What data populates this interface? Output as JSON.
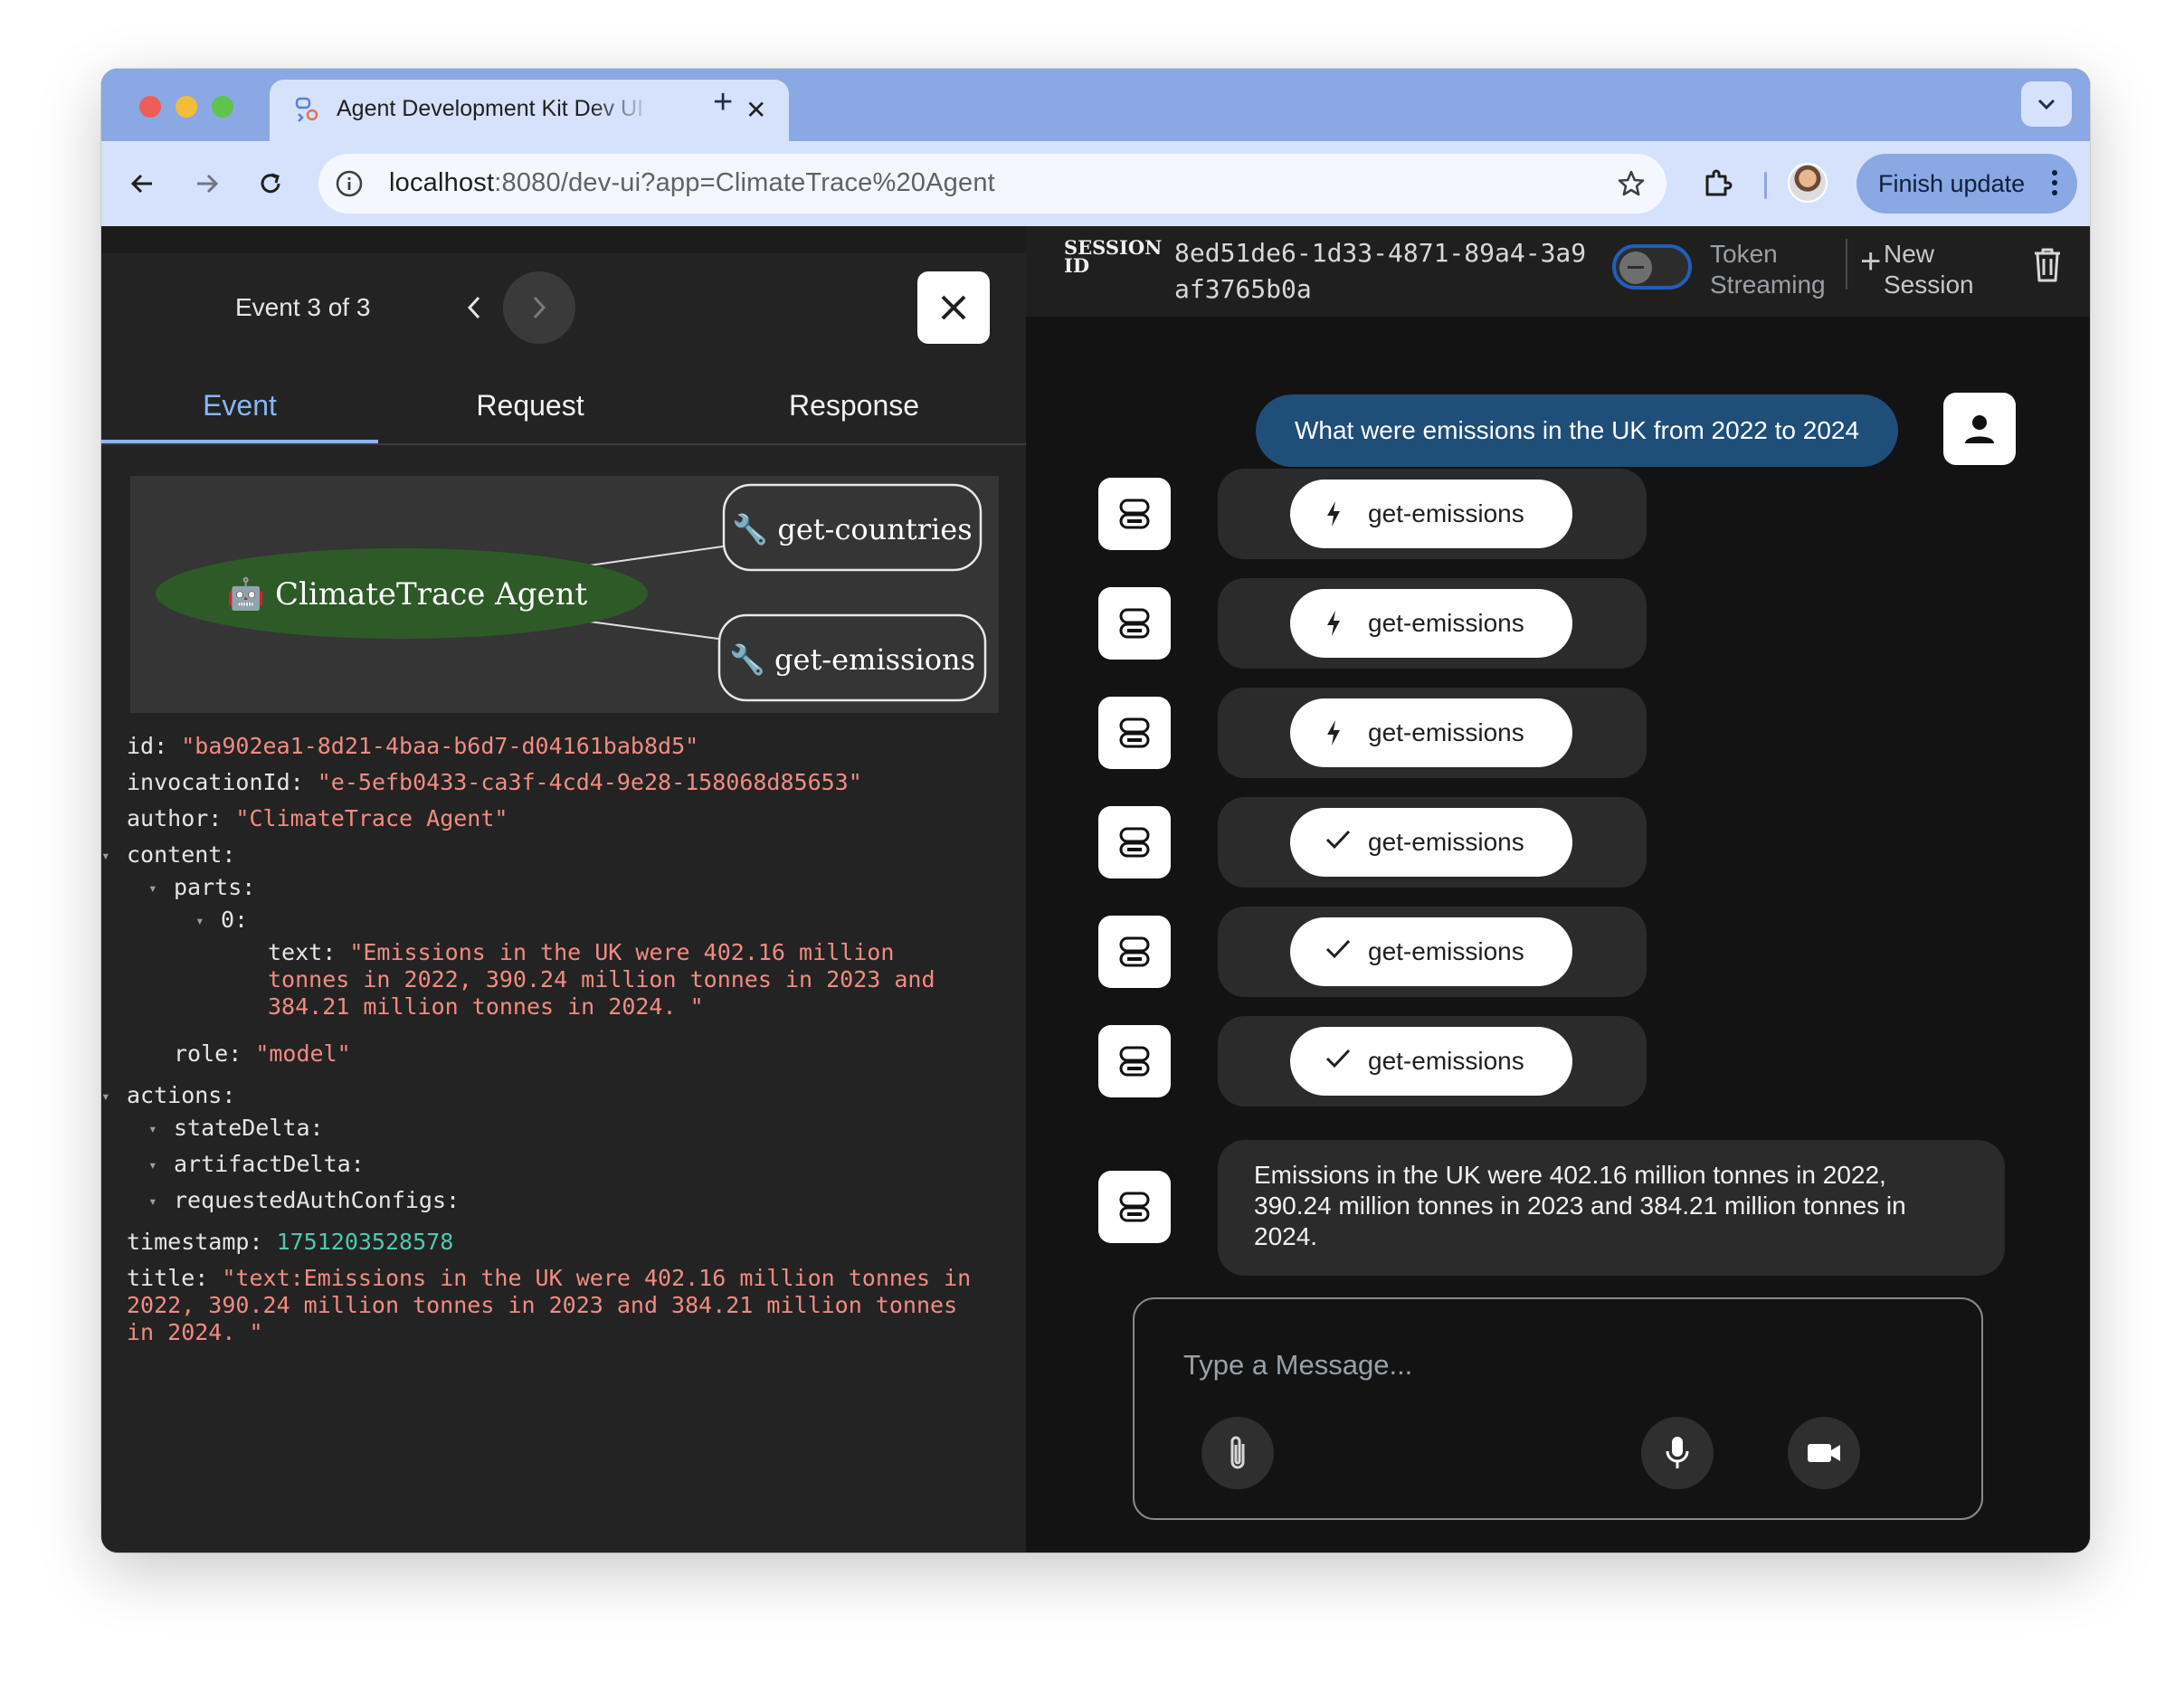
{
  "browser": {
    "tab_title": "Agent Development Kit Dev UI",
    "url_host": "localhost",
    "url_rest": ":8080/dev-ui?app=ClimateTrace%20Agent",
    "finish_update_label": "Finish update"
  },
  "event_panel": {
    "event_label": "Event 3 of 3",
    "tabs": [
      {
        "label": "Event",
        "active": true
      },
      {
        "label": "Request",
        "active": false
      },
      {
        "label": "Response",
        "active": false
      }
    ],
    "graph": {
      "agent_node": "🤖 ClimateTrace Agent",
      "tool_nodes": [
        "🔧 get-countries",
        "🔧 get-emissions"
      ]
    },
    "json": {
      "id": "\"ba902ea1-8d21-4baa-b6d7-d04161bab8d5\"",
      "invocationId": "\"e-5efb0433-ca3f-4cd4-9e28-158068d85653\"",
      "author": "\"ClimateTrace Agent\"",
      "text_lines": [
        "\"Emissions in the UK were 402.16 million",
        "tonnes in 2022, 390.24 million tonnes in 2023 and",
        "384.21 million tonnes in 2024. \""
      ],
      "role": "\"model\"",
      "timestamp": "1751203528578",
      "title_lines": [
        "\"text:Emissions in the UK were 402.16 million tonnes in",
        "2022, 390.24 million tonnes in 2023 and 384.21 million tonnes",
        "in 2024. \""
      ],
      "keys": {
        "id": "id:",
        "invocationId": "invocationId:",
        "author": "author:",
        "content": "content:",
        "parts": "parts:",
        "index0": "0:",
        "text": "text:",
        "role": "role:",
        "actions": "actions:",
        "stateDelta": "stateDelta:",
        "artifactDelta": "artifactDelta:",
        "requestedAuthConfigs": "requestedAuthConfigs:",
        "timestamp": "timestamp:",
        "title": "title:"
      }
    }
  },
  "session": {
    "label": "SESSION ID",
    "id": "8ed51de6-1d33-4871-89a4-3a9af3765b0a",
    "token_streaming_label": "Token Streaming",
    "token_streaming_on": false,
    "new_session_label": "New Session"
  },
  "chat": {
    "user_message": "What were emissions in the UK from 2022 to 2024",
    "function_events": [
      {
        "label": "get-emissions",
        "icon": "bolt-icon"
      },
      {
        "label": "get-emissions",
        "icon": "bolt-icon"
      },
      {
        "label": "get-emissions",
        "icon": "bolt-icon"
      },
      {
        "label": "get-emissions",
        "icon": "check-icon"
      },
      {
        "label": "get-emissions",
        "icon": "check-icon"
      },
      {
        "label": "get-emissions",
        "icon": "check-icon"
      }
    ],
    "reply": "Emissions in the UK were 402.16 million tonnes in 2022, 390.24 million tonnes in 2023 and 384.21 million tonnes in 2024.",
    "composer_placeholder": "Type a Message..."
  },
  "colors": {
    "accent_blue": "#8ab4f8",
    "user_bubble": "#1f4e79",
    "json_string": "#f28b82",
    "json_number": "#4ec9b0",
    "agent_node": "#2d5a27"
  }
}
